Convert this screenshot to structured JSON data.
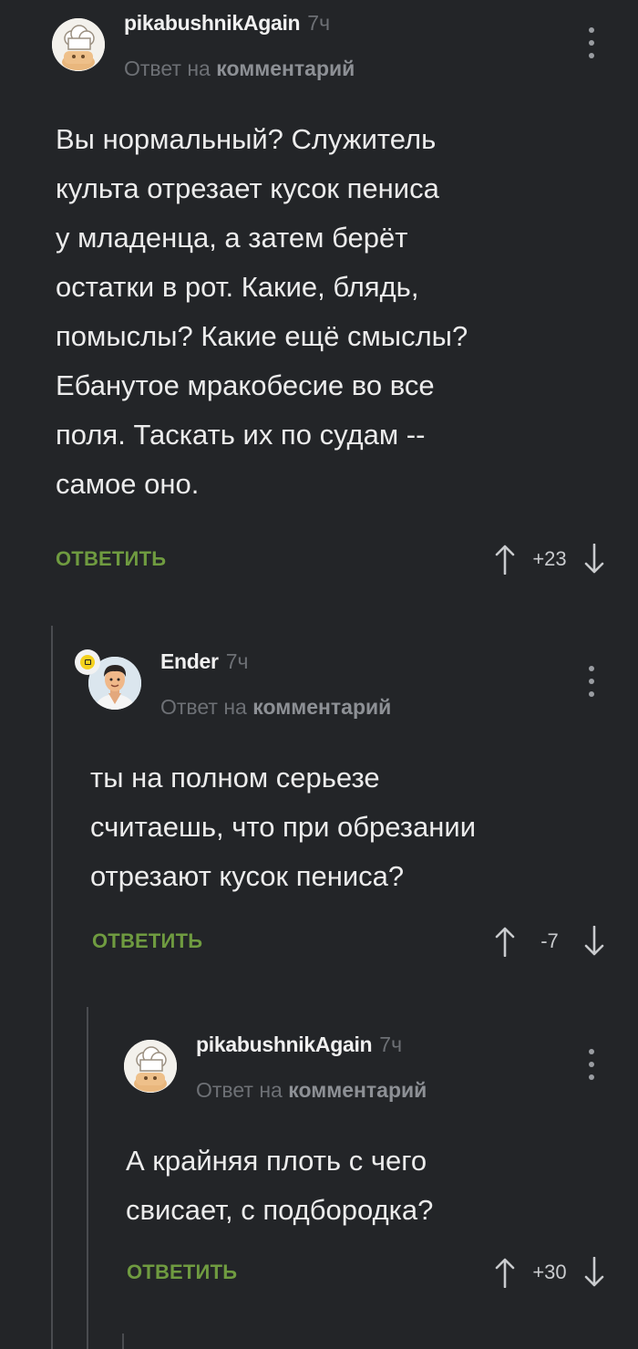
{
  "comments": [
    {
      "username": "pikabushnikAgain",
      "time": "7ч",
      "reply_prefix": "Ответ на",
      "reply_target": "комментарий",
      "text_lines": [
        "Вы нормальный? Служитель",
        "культа отрезает кусок пениса",
        "у младенца, а затем берёт",
        "остатки в рот. Какие, блядь,",
        "помыслы? Какие ещё смыслы?",
        "Ебанутое мракобесие во все",
        "поля. Таскать их по судам --",
        "самое оно."
      ],
      "reply_label": "ОТВЕТИТЬ",
      "score": "+23",
      "avatar": "chef-hat-avatar"
    },
    {
      "username": "Ender",
      "time": "7ч",
      "reply_prefix": "Ответ на",
      "reply_target": "комментарий",
      "text_lines": [
        "ты на полном серьезе",
        "считаешь, что при обрезании",
        "отрезают кусок пениса?"
      ],
      "reply_label": "ОТВЕТИТЬ",
      "score": "-7",
      "avatar": "cartoon-man-avatar"
    },
    {
      "username": "pikabushnikAgain",
      "time": "7ч",
      "reply_prefix": "Ответ на",
      "reply_target": "комментарий",
      "text_lines": [
        "А крайняя плоть с чего",
        "свисает, с подбородка?"
      ],
      "reply_label": "ОТВЕТИТЬ",
      "score": "+30",
      "avatar": "chef-hat-avatar"
    }
  ],
  "colors": {
    "background": "#232528",
    "reply_green": "#6f9b40",
    "muted": "#6d7075",
    "thread_line": "#4a4c50"
  }
}
